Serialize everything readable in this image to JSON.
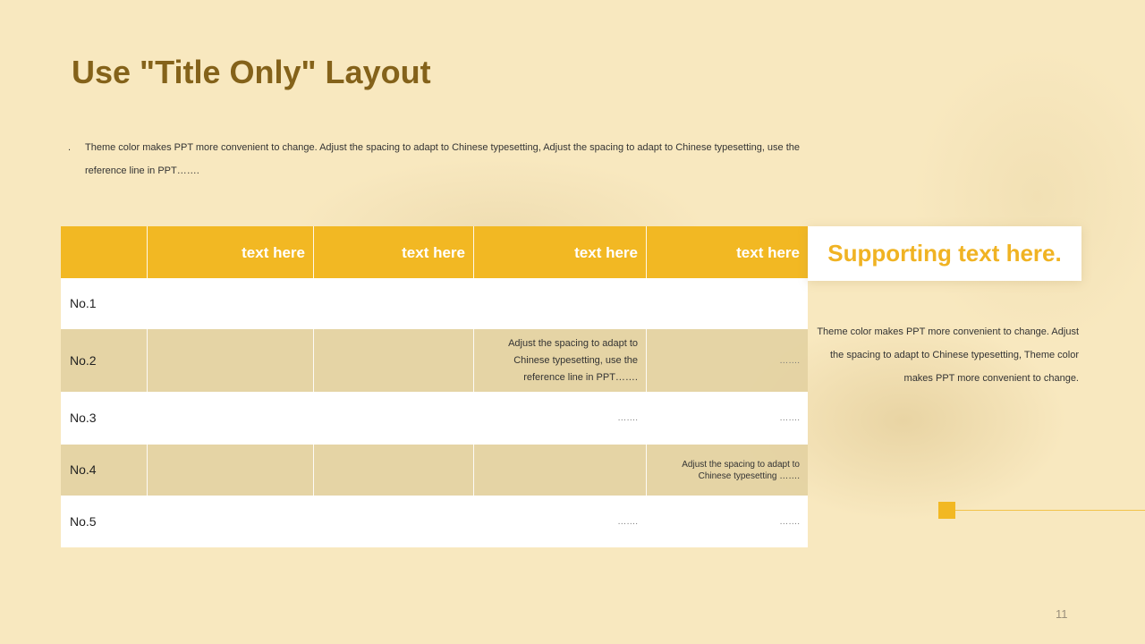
{
  "title": "Use \"Title Only\" Layout",
  "intro": {
    "bullet": ".",
    "text": "Theme color makes PPT more convenient  to change.  Adjust  the spacing to adapt to Chinese typesetting,  Adjust the spacing to adapt to Chinese typesetting,  use the reference  line in PPT……."
  },
  "table": {
    "headers": [
      "",
      "text here",
      "text here",
      "text here",
      "text here"
    ],
    "rows": [
      [
        "No.1",
        "",
        "",
        "",
        ""
      ],
      [
        "No.2",
        "",
        "",
        "Adjust the spacing to adapt to Chinese typesetting,  use the reference  line in PPT…….",
        "……."
      ],
      [
        "No.3",
        "",
        "",
        "…….",
        "……."
      ],
      [
        "No.4",
        "",
        "",
        "",
        "Adjust the spacing to adapt to Chinese typesetting ……."
      ],
      [
        "No.5",
        "",
        "",
        "…….",
        "……."
      ]
    ]
  },
  "support": {
    "heading": "Supporting  text  here.",
    "text": "Theme  color makes PPT more convenient  to change.  Adjust the spacing to adapt to Chinese typesetting,  Theme color makes PPT more convenient  to change."
  },
  "page_number": "11",
  "colors": {
    "accent": "#f2b823",
    "title": "#84621a",
    "background": "#f8e8bf"
  }
}
